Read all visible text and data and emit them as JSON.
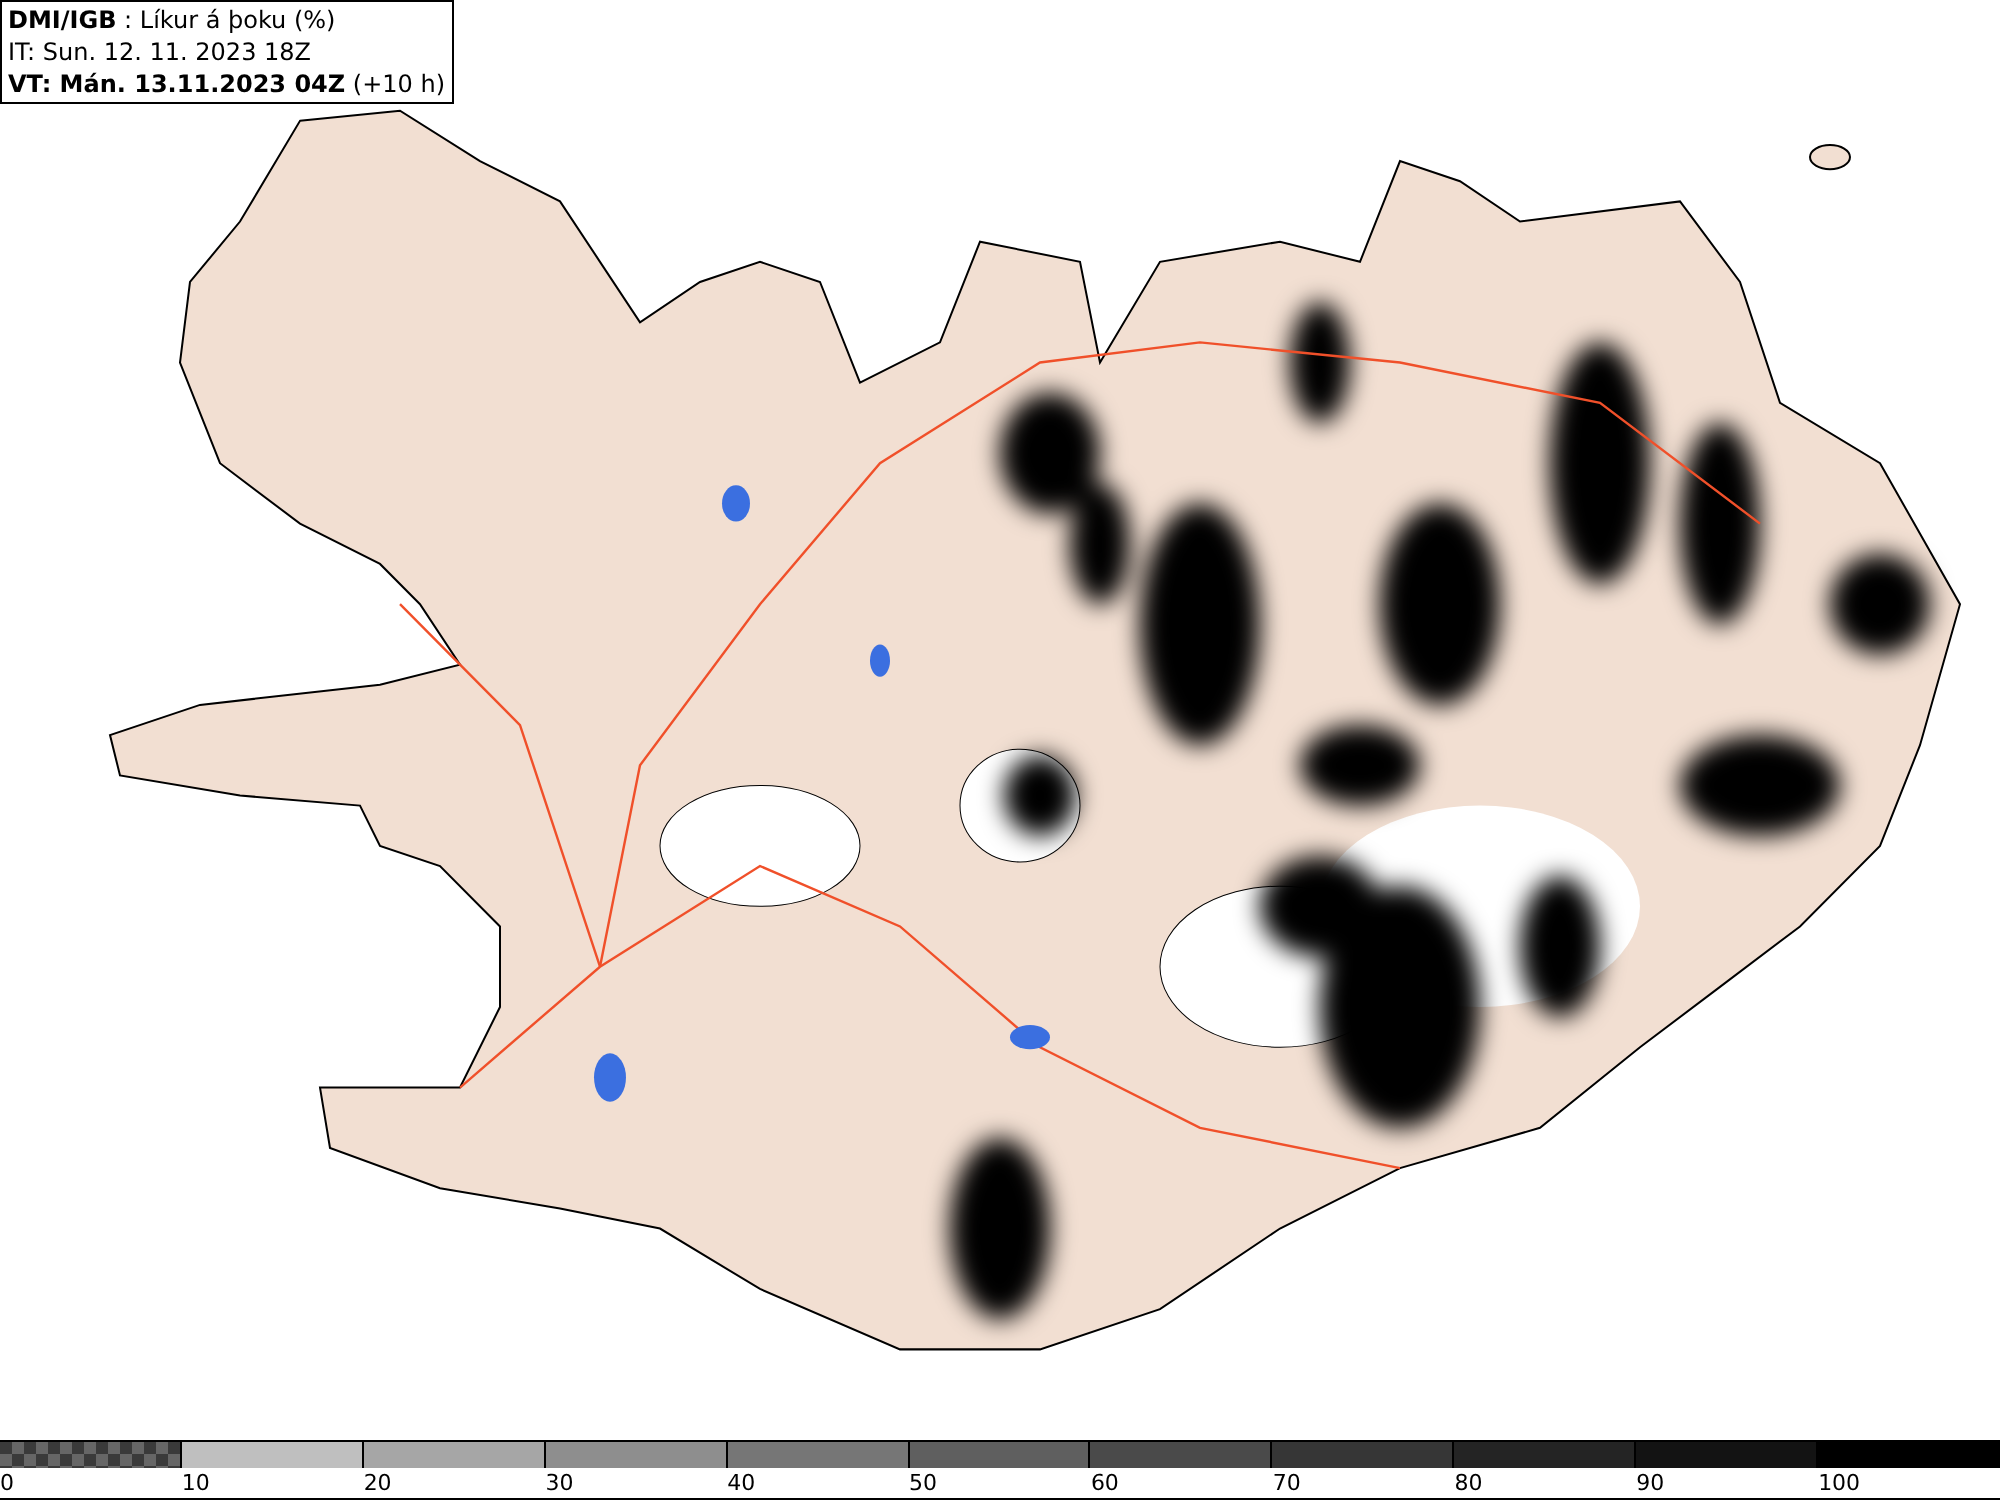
{
  "header": {
    "lines": [
      "**DMI/IGB** : Líkur á þoku (%)",
      "IT: Sun. 12. 11. 2023 18Z",
      "**VT: Mán. 13.11.2023 04Z** (+10 h)"
    ]
  },
  "legend": [
    {
      "label": "0",
      "color": "#666666",
      "kind": "checker"
    },
    {
      "label": "10",
      "color": "#bfbfbf",
      "kind": "solid"
    },
    {
      "label": "20",
      "color": "#a6a6a6",
      "kind": "solid"
    },
    {
      "label": "30",
      "color": "#8e8e8e",
      "kind": "solid"
    },
    {
      "label": "40",
      "color": "#767676",
      "kind": "solid"
    },
    {
      "label": "50",
      "color": "#5f5f5f",
      "kind": "solid"
    },
    {
      "label": "60",
      "color": "#4a4a4a",
      "kind": "solid"
    },
    {
      "label": "70",
      "color": "#363636",
      "kind": "solid"
    },
    {
      "label": "80",
      "color": "#242424",
      "kind": "solid"
    },
    {
      "label": "90",
      "color": "#131313",
      "kind": "solid"
    },
    {
      "label": "100",
      "color": "#000000",
      "kind": "solid"
    }
  ]
}
